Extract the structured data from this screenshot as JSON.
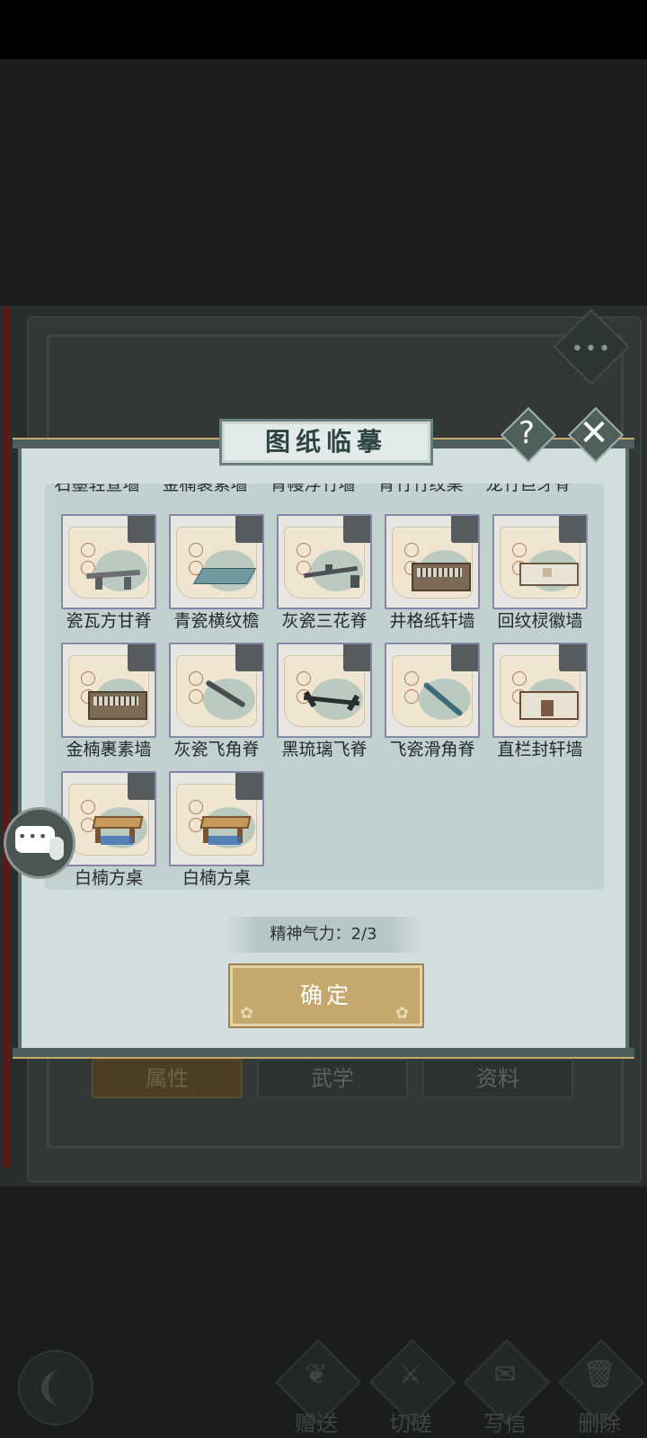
{
  "dialog": {
    "title": "图纸临摹",
    "help_icon": "?",
    "close_icon": "✕",
    "stamina_text": "精神气力：2/3",
    "confirm_label": "确定"
  },
  "partial_row_labels": [
    "石墨轻宣墙",
    "金楠裹素墙",
    "青幔浮竹墙",
    "青竹竹纹桌",
    "龙竹巨牙脊"
  ],
  "items": [
    {
      "name": "瓷瓦方甘脊",
      "kind": "ridge-flat"
    },
    {
      "name": "青瓷横纹檐",
      "kind": "eave"
    },
    {
      "name": "灰瓷三花脊",
      "kind": "ridge-three"
    },
    {
      "name": "井格纸轩墙",
      "kind": "wall-lattice"
    },
    {
      "name": "回纹棂徽墙",
      "kind": "wall-plain"
    },
    {
      "name": "金楠裹素墙",
      "kind": "wall-lattice"
    },
    {
      "name": "灰瓷飞角脊",
      "kind": "ridge-curve"
    },
    {
      "name": "黑琉璃飞脊",
      "kind": "ridge-black"
    },
    {
      "name": "飞瓷滑角脊",
      "kind": "ridge-blue"
    },
    {
      "name": "直栏封轩墙",
      "kind": "wall-door"
    },
    {
      "name": "白楠方桌",
      "kind": "table"
    },
    {
      "name": "白楠方桌",
      "kind": "table"
    }
  ],
  "book_tabs": [
    "属性",
    "武学",
    "资料"
  ],
  "bottom_actions": [
    {
      "label": "赠送",
      "icon": "scroll-icon"
    },
    {
      "label": "切磋",
      "icon": "sword-icon"
    },
    {
      "label": "写信",
      "icon": "letter-icon"
    },
    {
      "label": "删除",
      "icon": "trash-icon"
    }
  ]
}
